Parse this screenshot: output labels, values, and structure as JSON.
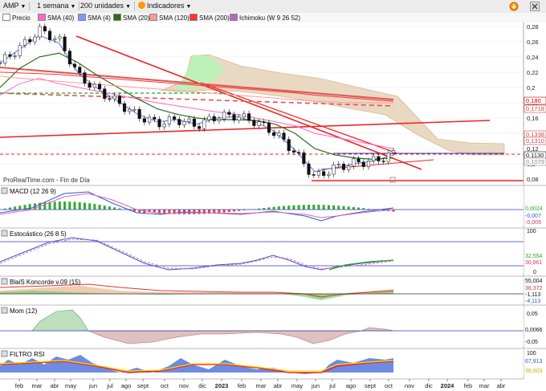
{
  "toolbar": {
    "symbol": "AMP",
    "timeframe": "1 semana",
    "bars": "200 unidades",
    "indicators_label": "Indicadores"
  },
  "legend": [
    {
      "label": "Precio",
      "color": "#ffffff"
    },
    {
      "label": "SMA (40)",
      "color": "#ff66cc"
    },
    {
      "label": "SMA (4)",
      "color": "#7799ff"
    },
    {
      "label": "SMA (20)",
      "color": "#2e6b1e"
    },
    {
      "label": "SMA (120)",
      "color": "#ff9999"
    },
    {
      "label": "SMA (200)",
      "color": "#ff3333"
    },
    {
      "label": "Ichimoku (W 9 26 52)",
      "color": "#bb66bb"
    }
  ],
  "source_label": "ProRealTime.com - Fin de Día",
  "price_axis": {
    "ticks": [
      "0,28",
      "0,26",
      "0,24",
      "0,22",
      "0,2",
      "0,18",
      "0,16",
      "0,14",
      "0,12",
      "0,1",
      "0,08"
    ],
    "labels": [
      {
        "text": "0,180",
        "color": "#cc0000"
      },
      {
        "text": "0,1718",
        "color": "#cc4444"
      },
      {
        "text": "0,1338",
        "color": "#cc4444"
      },
      {
        "text": "0,1310",
        "color": "#cc4444"
      },
      {
        "text": "0,1130",
        "color": "#111111"
      },
      {
        "text": "0,1079",
        "color": "#888888"
      }
    ]
  },
  "time_axis": [
    "feb",
    "mar",
    "abr",
    "may",
    "jun",
    "jul",
    "ago",
    "sept",
    "oct",
    "nov",
    "dic",
    "2023",
    "feb",
    "mar",
    "abr",
    "may",
    "jun",
    "jul",
    "ago",
    "sept",
    "oct",
    "nov",
    "dic",
    "2024",
    "feb",
    "mar",
    "abr"
  ],
  "panels": {
    "macd": {
      "title": "MACD (12 26 9)",
      "labels": [
        "0,0024",
        "-0,007",
        "-0,009"
      ]
    },
    "stoch": {
      "title": "Estocástico (26 8 5)",
      "labels": [
        "100",
        "32,554",
        "30,861",
        "0"
      ]
    },
    "koncorde": {
      "title": "BlaiS Koncorde v.09 (15)",
      "labels": [
        "55,004",
        "36,372",
        "-1,113",
        "-4,113"
      ]
    },
    "mom": {
      "title": "Mom (12)",
      "labels": [
        "0,05",
        "0,0066",
        "-0,05"
      ]
    },
    "filtro": {
      "title": "FILTRO RSI",
      "labels": [
        "100",
        "67,913",
        "38,603"
      ]
    }
  },
  "chart_data": {
    "type": "line",
    "title": "AMP",
    "x": [
      "feb-22",
      "mar-22",
      "abr-22",
      "may-22",
      "jun-22",
      "jul-22",
      "ago-22",
      "sept-22",
      "oct-22",
      "nov-22",
      "dic-22",
      "ene-23",
      "feb-23",
      "mar-23",
      "abr-23",
      "may-23",
      "jun-23",
      "jul-23",
      "ago-23",
      "sept-23",
      "oct-23"
    ],
    "series": [
      {
        "name": "Precio",
        "values": [
          0.232,
          0.252,
          0.275,
          0.262,
          0.215,
          0.196,
          0.18,
          0.163,
          0.153,
          0.158,
          0.15,
          0.162,
          0.163,
          0.155,
          0.14,
          0.115,
          0.082,
          0.095,
          0.101,
          0.104,
          0.113
        ]
      },
      {
        "name": "SMA (40)",
        "values": [
          0.19,
          0.205,
          0.212,
          0.205,
          0.2,
          0.195,
          0.19,
          0.185,
          0.18,
          0.176,
          0.172,
          0.168,
          0.165,
          0.16,
          0.155,
          0.15,
          0.14,
          0.135,
          0.13,
          0.125,
          0.12
        ]
      },
      {
        "name": "SMA (4)",
        "values": [
          0.232,
          0.25,
          0.268,
          0.258,
          0.218,
          0.198,
          0.182,
          0.165,
          0.155,
          0.158,
          0.152,
          0.16,
          0.162,
          0.155,
          0.142,
          0.118,
          0.09,
          0.095,
          0.1,
          0.104,
          0.112
        ]
      },
      {
        "name": "SMA (20)",
        "values": [
          0.2,
          0.225,
          0.24,
          0.245,
          0.232,
          0.215,
          0.2,
          0.185,
          0.172,
          0.165,
          0.16,
          0.158,
          0.158,
          0.157,
          0.152,
          0.14,
          0.12,
          0.112,
          0.108,
          0.106,
          0.108
        ]
      },
      {
        "name": "SMA (120)",
        "values": [
          0.215,
          0.212,
          0.21,
          0.208,
          0.206,
          0.204,
          0.202,
          0.2,
          0.198,
          0.196,
          0.194,
          0.192,
          0.19,
          0.188,
          0.186,
          0.184,
          0.182,
          0.181,
          0.18,
          0.18,
          0.18
        ]
      },
      {
        "name": "SMA (200)",
        "values": [
          0.22,
          0.219,
          0.218,
          0.217,
          0.215,
          0.213,
          0.211,
          0.209,
          0.207,
          0.205,
          0.203,
          0.201,
          0.199,
          0.197,
          0.195,
          0.193,
          0.19,
          0.188,
          0.186,
          0.184,
          0.182
        ]
      }
    ],
    "ylim": [
      0.075,
      0.285
    ],
    "grid": true,
    "legend_position": "top-left"
  }
}
